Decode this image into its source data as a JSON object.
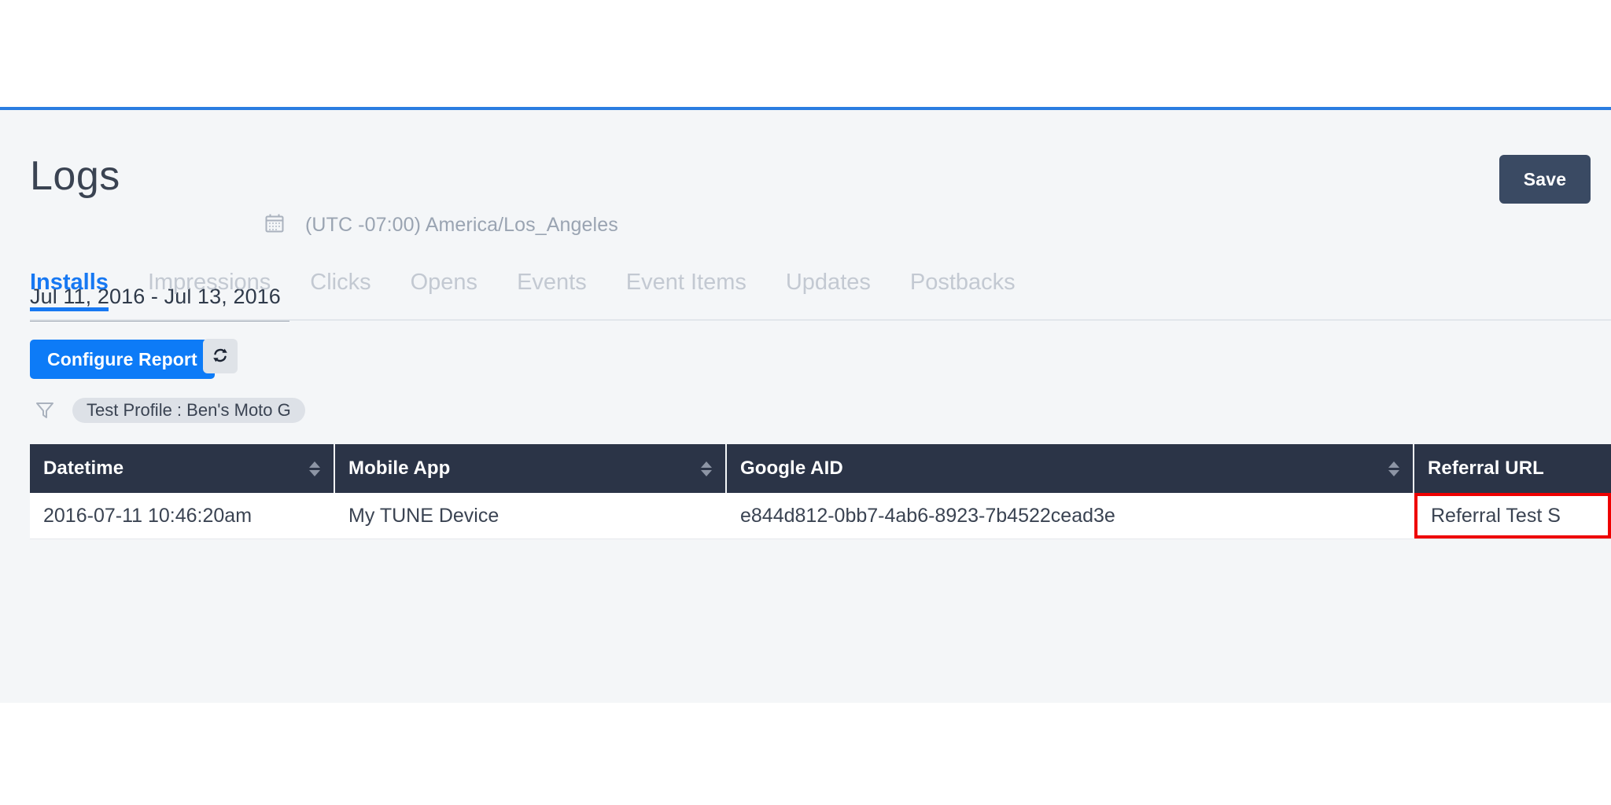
{
  "header": {
    "title": "Logs",
    "save_label": "Save"
  },
  "daterange": {
    "value": "Jul 11, 2016 - Jul 13, 2016",
    "calendar_icon": "calendar-icon",
    "timezone": "(UTC -07:00) America/Los_Angeles"
  },
  "tabs": [
    {
      "label": "Installs",
      "active": true
    },
    {
      "label": "Impressions",
      "active": false
    },
    {
      "label": "Clicks",
      "active": false
    },
    {
      "label": "Opens",
      "active": false
    },
    {
      "label": "Events",
      "active": false
    },
    {
      "label": "Event Items",
      "active": false
    },
    {
      "label": "Updates",
      "active": false
    },
    {
      "label": "Postbacks",
      "active": false
    }
  ],
  "actions": {
    "configure_label": "Configure Report",
    "refresh_icon": "refresh-icon"
  },
  "filters": {
    "funnel_icon": "filter-funnel-icon",
    "chips": [
      {
        "label": "Test Profile : Ben's Moto G"
      }
    ]
  },
  "table": {
    "columns": [
      {
        "label": "Datetime",
        "sortable": true
      },
      {
        "label": "Mobile App",
        "sortable": true
      },
      {
        "label": "Google AID",
        "sortable": true
      },
      {
        "label": "Referral URL",
        "sortable": false
      }
    ],
    "rows": [
      {
        "datetime": "2016-07-11 10:46:20am",
        "mobile_app": "My TUNE Device",
        "google_aid": "e844d812-0bb7-4ab6-8923-7b4522cead3e",
        "referral_url": "Referral Test S"
      }
    ]
  },
  "colors": {
    "accent_blue": "#1778f2",
    "button_blue": "#0d7bf7",
    "top_rule_blue": "#2a7de1",
    "header_navy": "#2b3447",
    "save_navy": "#3a4a63",
    "highlight_red": "#ee0000",
    "page_bg": "#f4f6f8"
  }
}
